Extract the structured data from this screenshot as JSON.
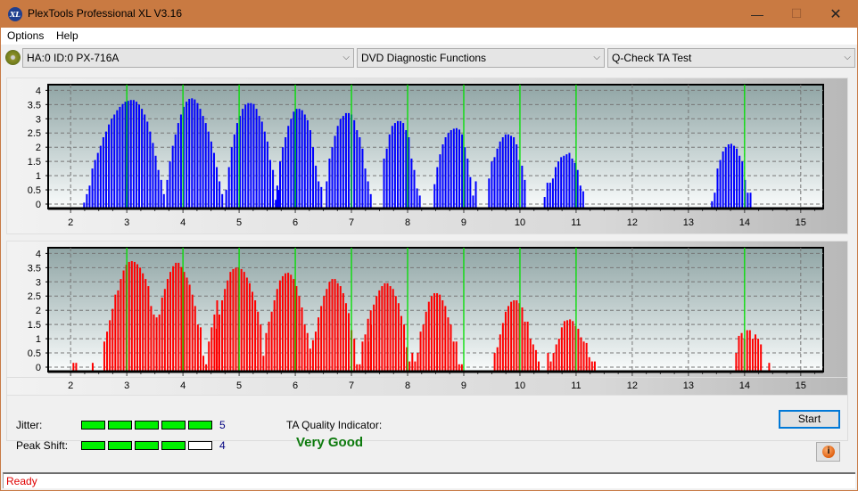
{
  "window": {
    "title": "PlexTools Professional XL V3.16",
    "icon": "xl-logo-icon",
    "icon_text": "XL",
    "controls": {
      "minimize": "—",
      "maximize": "☐",
      "close": "✕"
    }
  },
  "menu": [
    {
      "label": "Options"
    },
    {
      "label": "Help"
    }
  ],
  "toolbar": {
    "drive": "HA:0 ID:0  PX-716A",
    "function": "DVD Diagnostic Functions",
    "test": "Q-Check TA Test",
    "arrow": "⌵"
  },
  "results": {
    "jitter_label": "Jitter:",
    "jitter_value": "5",
    "jitter_level": 5,
    "peak_shift_label": "Peak Shift:",
    "peak_shift_value": "4",
    "peak_shift_level": 4,
    "max_level": 5,
    "quality_label": "TA Quality Indicator:",
    "quality_value": "Very Good"
  },
  "buttons": {
    "start": "Start",
    "info": "i"
  },
  "status": "Ready",
  "colors": {
    "top_bars": "#0000ff",
    "bottom_bars": "#ff0000",
    "marker_lines": "#00e000",
    "quality": "#0d7a0d",
    "status": "#e00000"
  },
  "chart_data": [
    {
      "type": "bar",
      "name": "top-chart",
      "title": "",
      "xlabel": "",
      "ylabel": "",
      "xlim": [
        1.6,
        15.4
      ],
      "ylim": [
        0,
        4.2
      ],
      "xticks": [
        2,
        3,
        4,
        5,
        6,
        7,
        8,
        9,
        10,
        11,
        12,
        13,
        14,
        15
      ],
      "yticks": [
        0,
        0.5,
        1,
        1.5,
        2,
        2.5,
        3,
        3.5,
        4
      ],
      "ytick_labels": [
        "0",
        "0.5",
        "1",
        "1.5",
        "2",
        "2.5",
        "3",
        "3.5",
        "4"
      ],
      "grid": true,
      "reference_lines": [
        3,
        4,
        5,
        6,
        7,
        8,
        9,
        10,
        11,
        14
      ],
      "bar_step": 0.049,
      "clusters": [
        {
          "start": 2.24,
          "values": [
            0.05,
            0.35,
            0.65,
            1.25,
            1.55,
            1.8,
            2.05,
            2.35,
            2.55,
            2.8,
            3.0,
            3.15,
            3.3,
            3.42,
            3.52,
            3.6,
            3.63,
            3.66,
            3.66,
            3.6,
            3.5,
            3.35,
            3.15,
            2.9,
            2.55,
            2.15,
            1.7,
            1.2,
            0.85,
            0.35
          ]
        },
        {
          "start": 3.72,
          "values": [
            0.85,
            1.5,
            2.05,
            2.45,
            2.85,
            3.15,
            3.42,
            3.6,
            3.7,
            3.72,
            3.68,
            3.55,
            3.35,
            3.1,
            2.85,
            2.55,
            2.2,
            1.8,
            1.3,
            0.8,
            0.35
          ]
        },
        {
          "start": 4.77,
          "values": [
            0.5,
            1.3,
            2.0,
            2.45,
            2.85,
            3.1,
            3.35,
            3.5,
            3.55,
            3.55,
            3.52,
            3.35,
            3.1,
            2.9,
            2.55,
            2.2,
            1.55,
            1.2,
            0.15,
            0.5
          ]
        },
        {
          "start": 5.68,
          "values": [
            0.65,
            1.5,
            2.0,
            2.35,
            2.75,
            3.0,
            3.25,
            3.35,
            3.35,
            3.3,
            3.15,
            2.95,
            2.6,
            2.0,
            1.35,
            0.8,
            0.6
          ]
        },
        {
          "start": 6.56,
          "values": [
            0.8,
            1.6,
            2.0,
            2.4,
            2.75,
            3.0,
            3.1,
            3.2,
            3.2,
            3.15,
            2.95,
            2.6,
            2.35,
            1.95,
            1.25,
            0.8,
            0.35
          ]
        },
        {
          "start": 7.58,
          "values": [
            1.6,
            1.95,
            2.45,
            2.75,
            2.85,
            2.92,
            2.92,
            2.85,
            2.6,
            2.35,
            1.6,
            1.2,
            0.55,
            0.3
          ]
        },
        {
          "start": 8.48,
          "values": [
            0.7,
            1.3,
            1.75,
            2.1,
            2.35,
            2.5,
            2.6,
            2.65,
            2.67,
            2.62,
            2.45,
            2.0,
            1.6,
            0.95,
            0.3,
            0.8
          ]
        },
        {
          "start": 9.45,
          "values": [
            0.9,
            1.5,
            1.65,
            1.95,
            2.2,
            2.35,
            2.45,
            2.45,
            2.4,
            2.35,
            2.1,
            1.55,
            1.35,
            0.85
          ]
        },
        {
          "start": 10.44,
          "values": [
            0.25,
            0.75,
            0.75,
            0.9,
            1.3,
            1.5,
            1.65,
            1.7,
            1.75,
            1.8,
            1.6,
            1.45,
            1.2,
            0.65,
            0.45
          ]
        },
        {
          "start": 13.42,
          "values": [
            0.1,
            0.4,
            1.25,
            1.55,
            1.85,
            2.0,
            2.1,
            2.12,
            2.05,
            1.95,
            1.7,
            1.5,
            0.85,
            0.4,
            0.4
          ]
        }
      ]
    },
    {
      "type": "bar",
      "name": "bottom-chart",
      "title": "",
      "xlabel": "",
      "ylabel": "",
      "xlim": [
        1.6,
        15.4
      ],
      "ylim": [
        0,
        4.2
      ],
      "xticks": [
        2,
        3,
        4,
        5,
        6,
        7,
        8,
        9,
        10,
        11,
        12,
        13,
        14,
        15
      ],
      "yticks": [
        0,
        0.5,
        1,
        1.5,
        2,
        2.5,
        3,
        3.5,
        4
      ],
      "ytick_labels": [
        "0",
        "0.5",
        "1",
        "1.5",
        "2",
        "2.5",
        "3",
        "3.5",
        "4"
      ],
      "grid": true,
      "reference_lines": [
        3,
        4,
        5,
        6,
        7,
        8,
        9,
        10,
        11,
        14
      ],
      "bar_step": 0.049,
      "clusters": [
        {
          "start": 2.05,
          "values": [
            0.15,
            0.15,
            0,
            0,
            0,
            0,
            0,
            0.15
          ]
        },
        {
          "start": 2.6,
          "values": [
            0.9,
            1.25,
            1.65,
            2.05,
            2.55,
            2.7,
            3.1,
            3.4,
            3.6,
            3.7,
            3.73,
            3.7,
            3.62,
            3.5,
            3.3,
            3.1,
            2.85,
            2.15,
            1.85,
            1.75,
            1.85,
            2.45,
            2.75,
            3.1,
            3.35,
            3.55,
            3.67,
            3.67,
            3.52,
            3.35,
            3.15,
            2.9,
            2.55,
            2.15,
            1.5,
            1.4,
            0.4,
            0.1,
            0.9,
            1.4,
            1.85,
            2.35
          ]
        },
        {
          "start": 4.6,
          "values": [
            1.35,
            1.85,
            2.35,
            2.75,
            3.05,
            3.35,
            3.45,
            3.5,
            3.5,
            3.45,
            3.35,
            3.15,
            2.95,
            2.65,
            2.35,
            1.95,
            1.5,
            0.4,
            1.2,
            1.6,
            1.95,
            2.35,
            2.75,
            3.05,
            3.2,
            3.3,
            3.32,
            3.25,
            3.1,
            2.85,
            2.5,
            2.1,
            1.5,
            1.2,
            0.65,
            0.95,
            1.25,
            1.75,
            2.15,
            2.5,
            2.75,
            3.0,
            3.1,
            3.1,
            2.95,
            2.85,
            2.6,
            2.25,
            1.9,
            1.3,
            1.0,
            0.1,
            0.1,
            0.9,
            1.15,
            1.7,
            2.0
          ]
        },
        {
          "start": 7.3,
          "values": [
            0.9,
            1.5,
            2.2,
            2.5,
            2.7,
            2.85,
            2.95,
            2.95,
            2.85,
            2.75,
            2.5,
            2.25,
            1.8,
            1.5,
            0.7,
            0.2,
            0.5,
            0.2,
            0.5,
            1.25,
            1.5,
            1.95,
            2.3,
            2.5,
            2.6,
            2.6,
            2.55,
            2.35,
            2.15,
            1.75,
            1.5,
            0.9,
            0.9,
            0.1,
            0.1
          ]
        },
        {
          "start": 9.55,
          "values": [
            0.5,
            0.7,
            1.15,
            1.55,
            1.95,
            2.15,
            2.3,
            2.35,
            2.35,
            2.25,
            2.1,
            1.6,
            1.6,
            1.0,
            0.8,
            0.6,
            0.2
          ]
        },
        {
          "start": 10.5,
          "values": [
            0.5,
            0.2,
            0.5,
            0.8,
            1.0,
            1.4,
            1.62,
            1.65,
            1.68,
            1.62,
            1.45,
            1.35,
            1.05,
            0.9,
            0.85,
            0.35,
            0.2,
            0.2
          ]
        },
        {
          "start": 13.85,
          "values": [
            0.5,
            1.1,
            1.2,
            1.0,
            1.3,
            1.3,
            1.0,
            1.15,
            1.0,
            0.8,
            0,
            0,
            0.15
          ]
        }
      ]
    }
  ]
}
